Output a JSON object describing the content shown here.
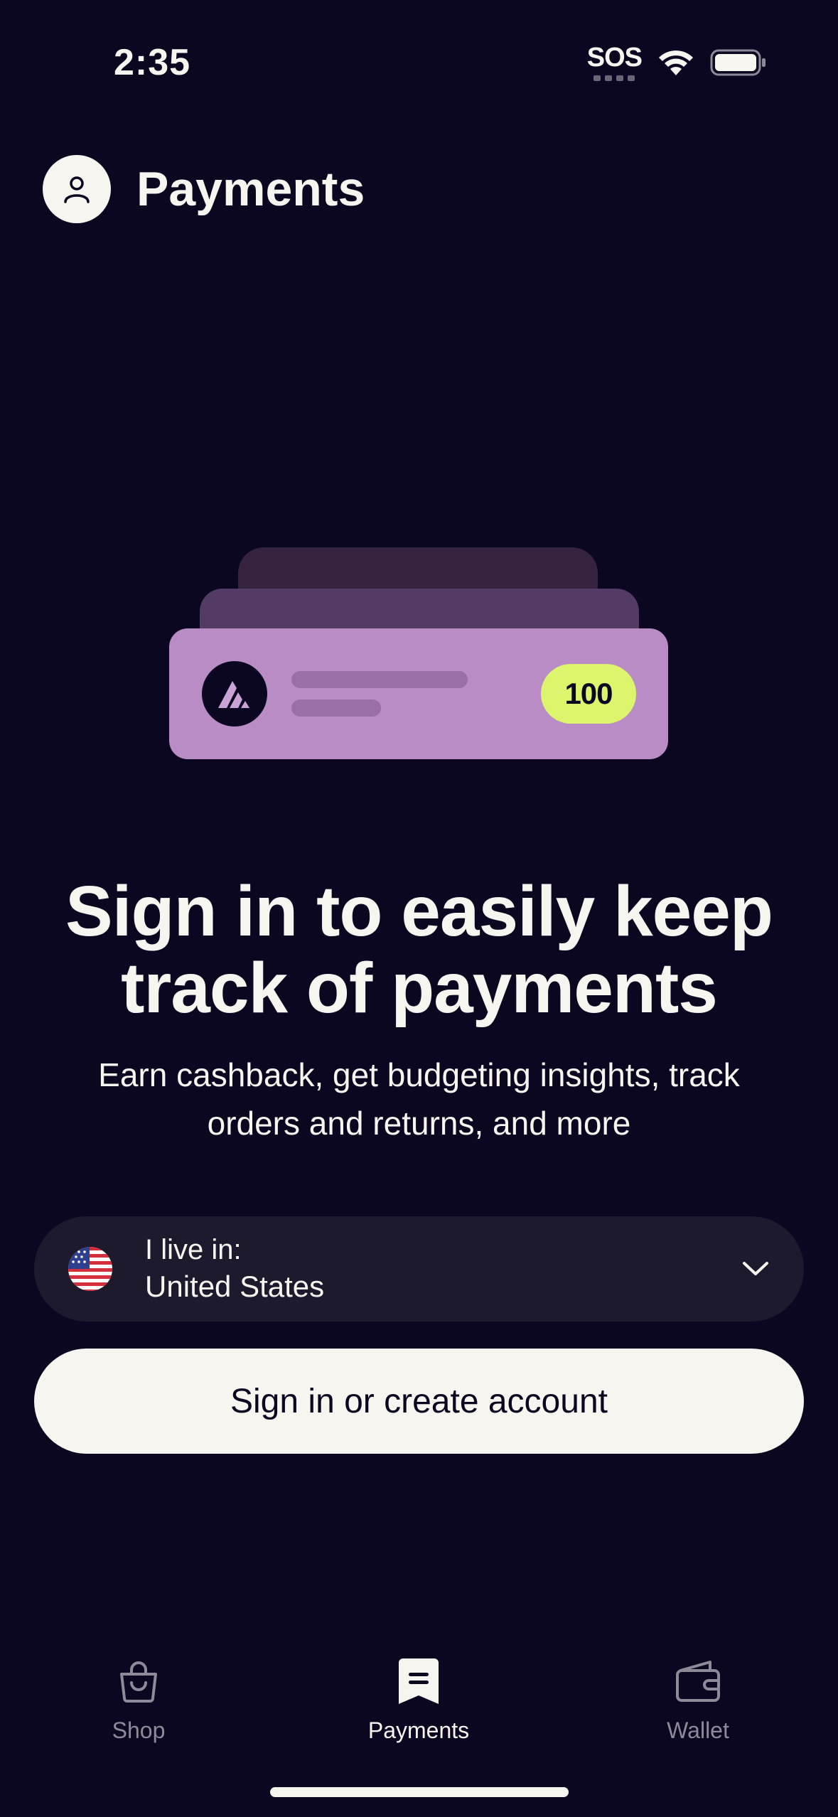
{
  "status_bar": {
    "time": "2:35",
    "sos": "SOS"
  },
  "header": {
    "title": "Payments"
  },
  "card": {
    "badge_value": "100"
  },
  "main": {
    "headline_line1": "Sign in to easily keep",
    "headline_line2": "track of payments",
    "subtext": "Earn cashback, get budgeting insights, track orders and returns, and more"
  },
  "country_select": {
    "label": "I live in:",
    "value": "United States"
  },
  "actions": {
    "sign_in_label": "Sign in or create account"
  },
  "tab_bar": {
    "tabs": [
      {
        "label": "Shop",
        "icon": "shopping-bag-icon",
        "active": false
      },
      {
        "label": "Payments",
        "icon": "receipt-icon",
        "active": true
      },
      {
        "label": "Wallet",
        "icon": "wallet-icon",
        "active": false
      }
    ]
  },
  "colors": {
    "background": "#0b0720",
    "card_front": "#b98cc6",
    "badge": "#dcf56c",
    "button": "#f7f5f0"
  }
}
